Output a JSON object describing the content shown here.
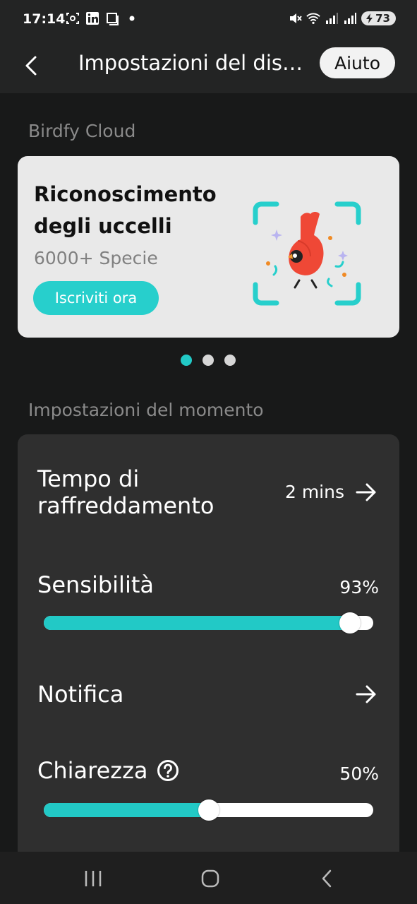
{
  "status": {
    "time": "17:14",
    "battery": "73",
    "icons": [
      "screenshot-icon",
      "linkedin-icon",
      "window-icon",
      "dot-icon",
      "mute-icon",
      "wifi-icon",
      "signal-icon",
      "signal-icon-2",
      "battery-icon"
    ]
  },
  "header": {
    "title": "Impostazioni del dis…",
    "help_label": "Aiuto"
  },
  "cloud": {
    "section_label": "Birdfy Cloud",
    "card_title": "Riconoscimento degli uccelli",
    "card_subtitle": "6000+ Specie",
    "cta_label": "Iscriviti ora"
  },
  "carousel": {
    "pages": 3,
    "active": 0
  },
  "settings": {
    "section_label": "Impostazioni del momento",
    "cooldown_label": "Tempo di raffreddamento",
    "cooldown_value": "2 mins",
    "sensitivity_label": "Sensibilità",
    "sensitivity_value": "93%",
    "sensitivity_level": 0.93,
    "notification_label": "Notifica",
    "clarity_label": "Chiarezza",
    "clarity_value": "50%",
    "clarity_level": 0.5
  },
  "colors": {
    "accent": "#22c9c6",
    "background": "#181919",
    "card": "#2f2f2f",
    "promo_card": "#e9e9e9"
  }
}
